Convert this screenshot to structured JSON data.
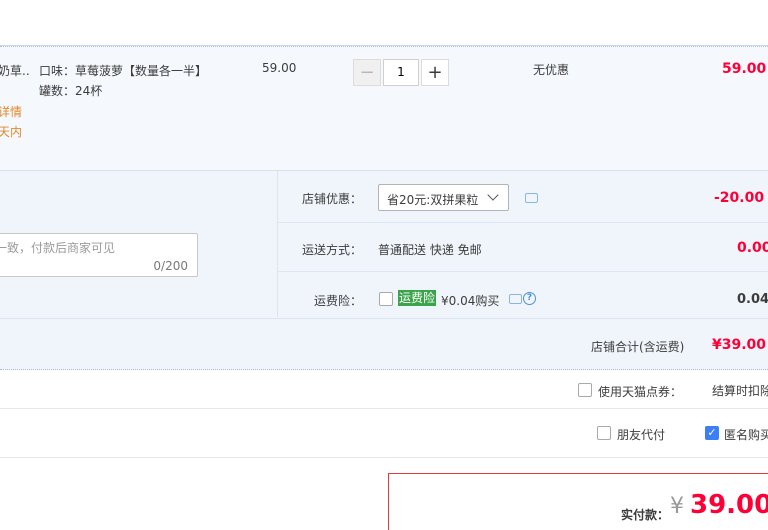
{
  "item": {
    "name_fragment": "奶草...",
    "details_link": "详情",
    "days_note": "天内",
    "sku_flavor": "口味：草莓菠萝【数量各一半】",
    "sku_cans": "罐数：24杯",
    "unit_price": "59.00",
    "qty_minus": "−",
    "quantity": "1",
    "qty_plus": "+",
    "discount": "无优惠",
    "subtotal": "59.00"
  },
  "order": {
    "message_placeholder": "一致，付款后商家可见",
    "message_counter": "0/200",
    "shop_discount_label": "店铺优惠：",
    "shop_discount_value": "省20元:双拼果粒",
    "shop_discount_amount": "-20.00",
    "shipping_label": "运送方式：",
    "shipping_value": "普通配送 快递 免邮",
    "shipping_amount": "0.00",
    "insurance_label": "运费险：",
    "insurance_tag": "运费险",
    "insurance_price": "¥0.04购买",
    "insurance_amount": "0.04",
    "shop_total_label": "店铺合计(含运费)",
    "shop_total_value": "¥39.00"
  },
  "options": {
    "tmall_coupon_label": "使用天猫点券：",
    "settle_note": "结算时扣除",
    "friend_pay_label": "朋友代付",
    "anonymous_label": "匿名购买",
    "anonymous_check": "✓"
  },
  "payment": {
    "label": "实付款：",
    "currency": "¥",
    "amount": "39.00"
  },
  "colors": {
    "accent_red": "#ff0036",
    "link_orange": "#e08a2b",
    "insurance_green": "#3aa44a",
    "checkbox_blue": "#3b7ef5"
  }
}
